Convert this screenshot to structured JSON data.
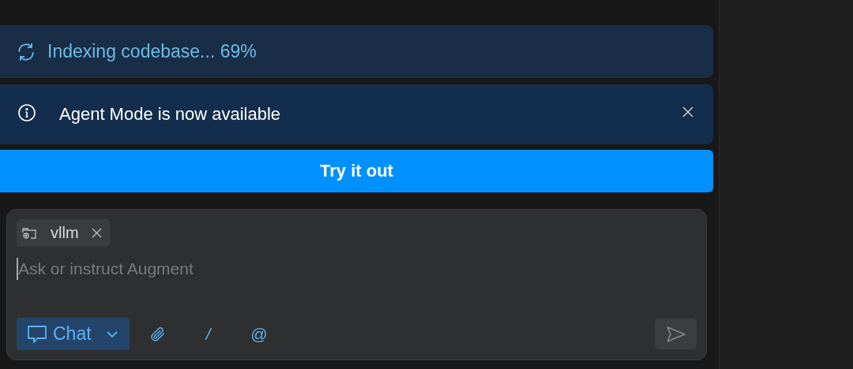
{
  "indexing": {
    "text": "Indexing codebase... 69%"
  },
  "notice": {
    "text": "Agent Mode is now available"
  },
  "try_button": {
    "label": "Try it out"
  },
  "composer": {
    "context_chips": [
      {
        "label": "vllm"
      }
    ],
    "placeholder": "Ask or instruct Augment",
    "mode": {
      "label": "Chat"
    },
    "commands": [
      "/",
      "@"
    ]
  }
}
